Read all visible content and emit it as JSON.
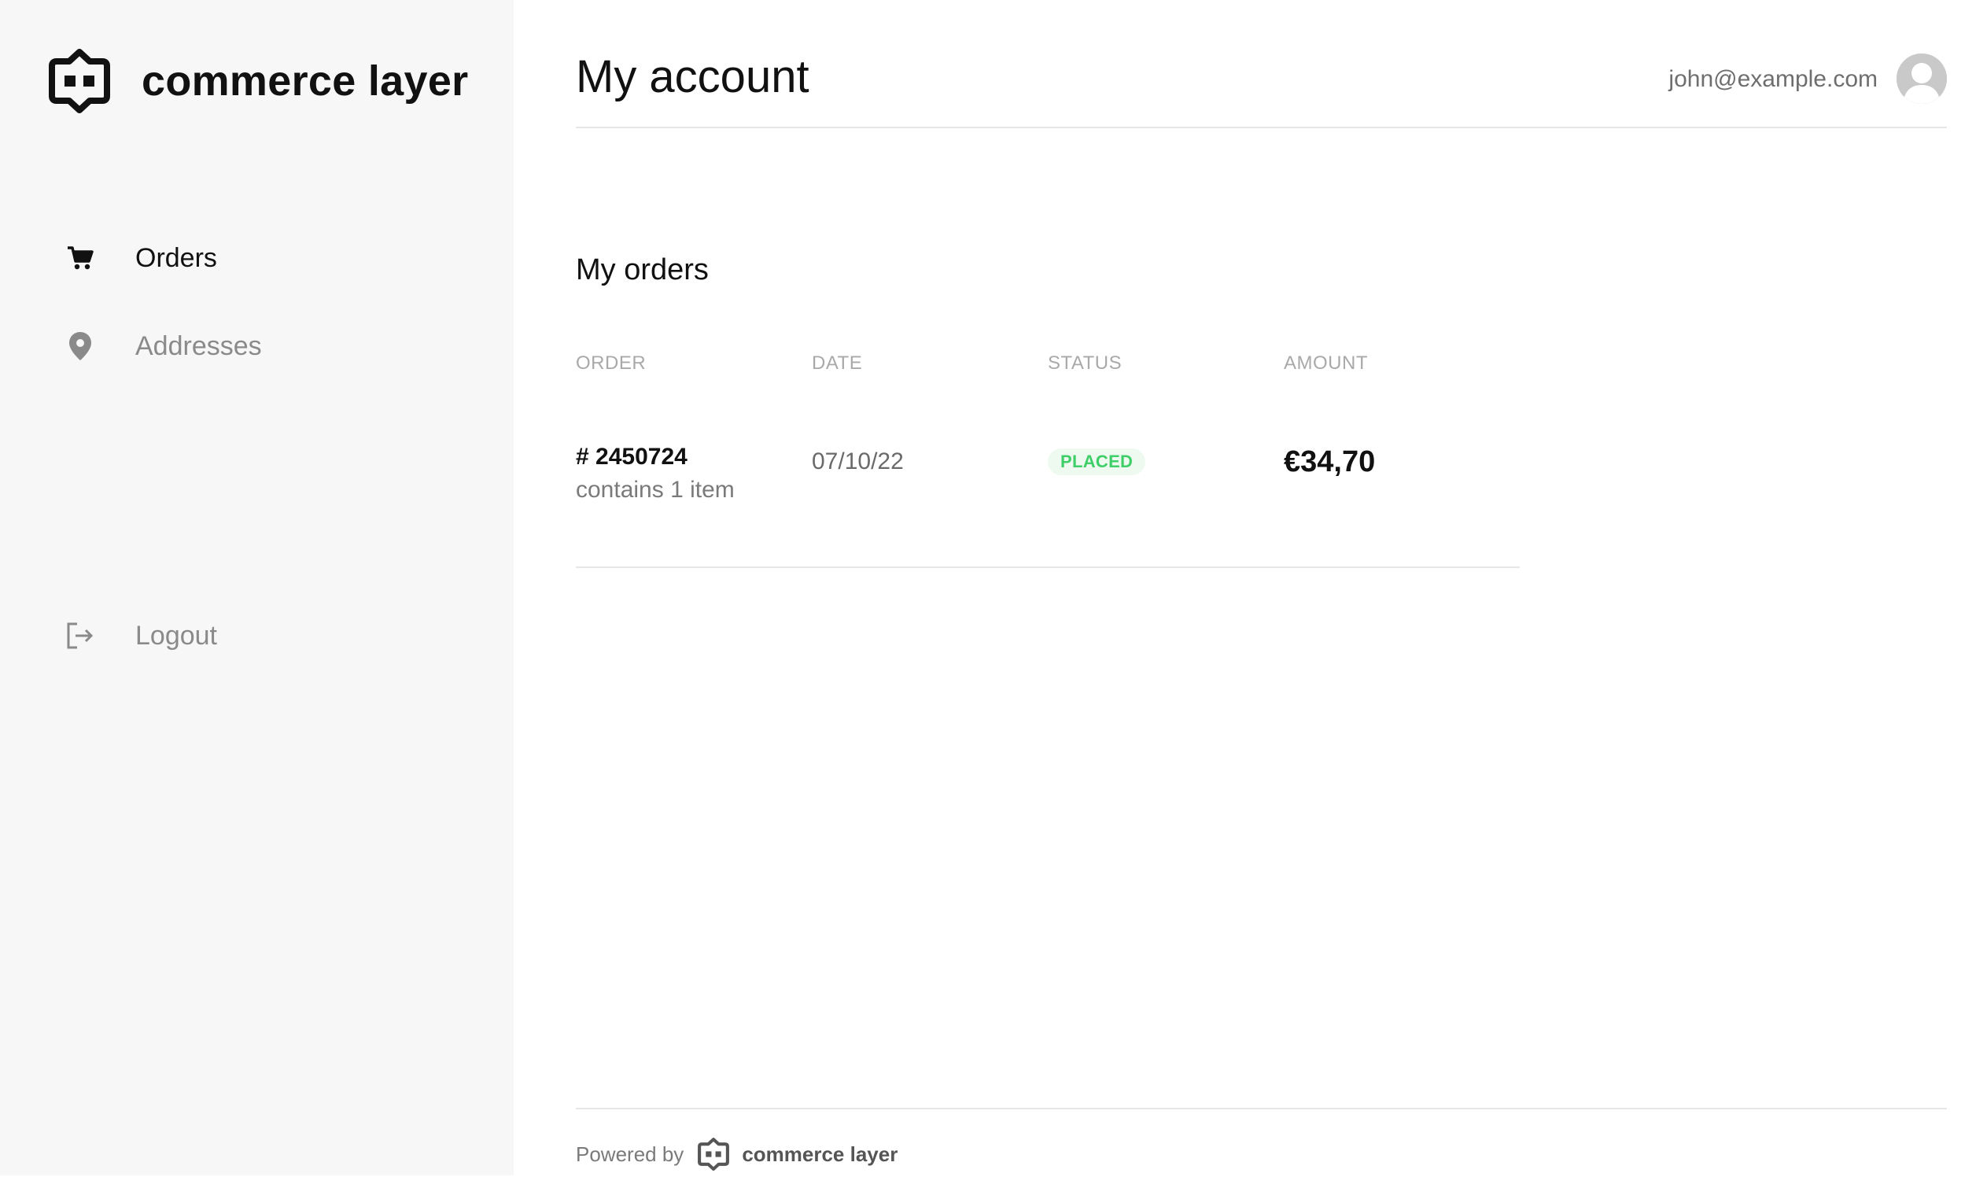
{
  "brand": {
    "name": "commerce layer",
    "icon": "commerce-layer-logo"
  },
  "sidebar": {
    "items": [
      {
        "label": "Orders",
        "icon": "cart-icon",
        "active": true
      },
      {
        "label": "Addresses",
        "icon": "map-pin-icon",
        "active": false
      }
    ],
    "logout": {
      "label": "Logout",
      "icon": "logout-icon"
    }
  },
  "header": {
    "title": "My account",
    "user_email": "john@example.com",
    "avatar_icon": "user-avatar-icon"
  },
  "orders": {
    "title": "My orders",
    "columns": [
      "ORDER",
      "DATE",
      "STATUS",
      "AMOUNT"
    ],
    "rows": [
      {
        "number": "# 2450724",
        "items": "contains 1 item",
        "date": "07/10/22",
        "status": "PLACED",
        "amount": "€34,70"
      }
    ]
  },
  "footer": {
    "powered_by": "Powered by",
    "brand": "commerce layer"
  },
  "colors": {
    "sidebar_bg": "#f7f7f7",
    "status_placed": "#3ecf69",
    "status_placed_bg": "#eef9f0"
  }
}
